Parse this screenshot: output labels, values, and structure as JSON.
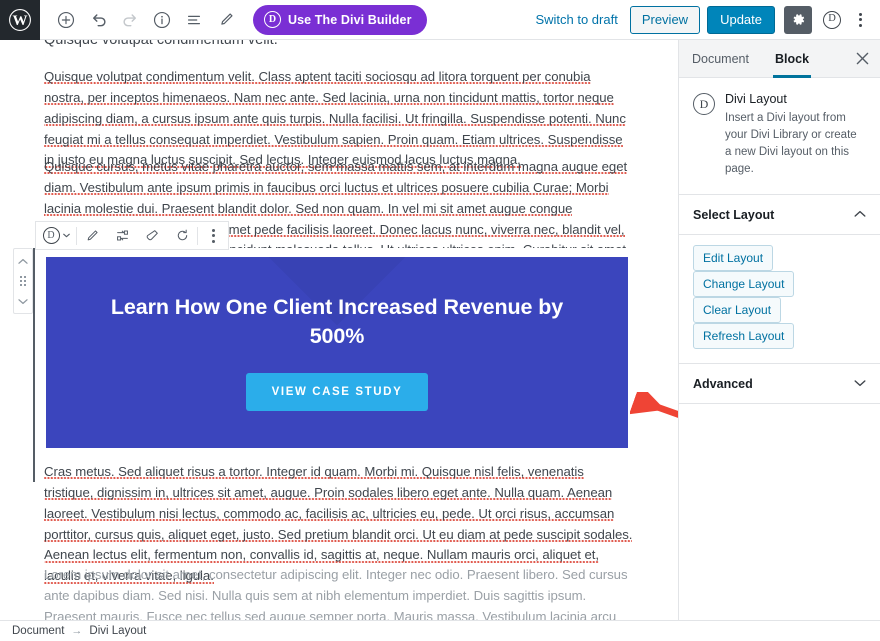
{
  "topbar": {
    "logo_icon": "wordpress-logo-icon",
    "tools": [
      {
        "name": "add-block-button",
        "icon": "plus-circle-icon",
        "disabled": false
      },
      {
        "name": "undo-button",
        "icon": "undo-arrow-icon",
        "disabled": false
      },
      {
        "name": "redo-button",
        "icon": "redo-arrow-icon",
        "disabled": true
      },
      {
        "name": "content-info-button",
        "icon": "info-circle-icon",
        "disabled": false
      },
      {
        "name": "block-navigation-button",
        "icon": "list-lines-icon",
        "disabled": false
      },
      {
        "name": "edit-mode-button",
        "icon": "pencil-icon",
        "disabled": false
      }
    ],
    "divi_builder_label": "Use The Divi Builder",
    "divi_builder_icon": "divi-d-icon",
    "divi_builder_color": "#7a2fd4",
    "switch_to_draft": "Switch to draft",
    "preview": "Preview",
    "update": "Update",
    "update_color": "#0085ba",
    "settings_icon": "gear-icon",
    "divi_toggle_icon": "divi-d-icon",
    "more_icon": "vertical-dots-icon"
  },
  "sidebar": {
    "tabs": [
      {
        "label": "Document",
        "active": false
      },
      {
        "label": "Block",
        "active": true
      }
    ],
    "close_icon": "close-x-icon",
    "block_card": {
      "icon": "divi-d-icon",
      "title": "Divi Layout",
      "description": "Insert a Divi layout from your Divi Library or create a new Divi layout on this page."
    },
    "select_layout": {
      "title": "Select Layout",
      "chevron": "chevron-up-icon",
      "buttons": [
        "Edit Layout",
        "Change Layout",
        "Clear Layout",
        "Refresh Layout"
      ]
    },
    "advanced": {
      "title": "Advanced",
      "chevron": "chevron-down-icon"
    }
  },
  "editor": {
    "clipped_top_text": "Quisque volutpat condimentum velit.",
    "paragraph_1": "Quisque volutpat condimentum velit. Class aptent taciti sociosqu ad litora torquent per conubia nostra, per inceptos himenaeos. Nam nec ante. Sed lacinia, urna non tincidunt mattis, tortor neque adipiscing diam, a cursus ipsum ante quis turpis. Nulla facilisi. Ut fringilla. Suspendisse potenti. Nunc feugiat mi a tellus consequat imperdiet. Vestibulum sapien. Proin quam. Etiam ultrices. Suspendisse in justo eu magna luctus suscipit. Sed lectus. Integer euismod lacus luctus magna.",
    "paragraph_2": "Quisque cursus, metus vitae pharetra auctor, sem massa mattis sem, at interdum magna augue eget diam. Vestibulum ante ipsum primis in faucibus orci luctus et ultrices posuere cubilia Curae; Morbi lacinia molestie dui. Praesent blandit dolor. Sed non quam. In vel mi sit amet augue congue elementum. Morbi in ipsum sit amet pede facilisis laoreet. Donec lacus nunc, viverra nec, blandit vel, egestas et, augue. Vestibulum tincidunt malesuada tellus. Ut ultrices ultrices enim. Curabitur sit amet pulvinar ullamcorper. Nulla facilisi. Integer lacinia sollicitudin massa.",
    "paragraph_3": "Cras metus. Sed aliquet risus a tortor. Integer id quam. Morbi mi. Quisque nisl felis, venenatis tristique, dignissim in, ultrices sit amet, augue. Proin sodales libero eget ante. Nulla quam. Aenean laoreet. Vestibulum nisi lectus, commodo ac, facilisis ac, ultricies eu, pede. Ut orci risus, accumsan porttitor, cursus quis, aliquet eget, justo. Sed pretium blandit orci. Ut eu diam at pede suscipit sodales. Aenean lectus elit, fermentum non, convallis id, sagittis at, neque. Nullam mauris orci, aliquet et, iaculis et, viverra vitae, ligula.",
    "paragraph_4": "Lorem ipsum dolor sit amet, consectetur adipiscing elit. Integer nec odio. Praesent libero. Sed cursus ante dapibus diam. Sed nisi. Nulla quis sem at nibh elementum imperdiet. Duis sagittis ipsum. Praesent mauris. Fusce nec tellus sed augue semper porta. Mauris massa. Vestibulum lacinia arcu eget nulla."
  },
  "divi_block": {
    "toolbar": {
      "block_type_icon": "divi-d-icon",
      "block_type_caret": "chevron-down-icon",
      "items": [
        {
          "name": "edit-layout-icon",
          "icon": "pencil-icon"
        },
        {
          "name": "change-layout-icon",
          "icon": "shuffle-icon"
        },
        {
          "name": "clear-layout-icon",
          "icon": "eraser-icon"
        },
        {
          "name": "refresh-layout-icon",
          "icon": "refresh-circle-icon"
        }
      ],
      "more_icon": "vertical-dots-icon"
    },
    "movers": {
      "up_icon": "chevron-up-icon",
      "drag_icon": "drag-grip-icon",
      "down_icon": "chevron-down-icon"
    },
    "banner": {
      "title": "Learn How One Client Increased Revenue by 500%",
      "button_label": "VIEW CASE STUDY",
      "background_color": "#3b45bd",
      "button_color": "#2badea",
      "title_color": "#ffffff"
    }
  },
  "annotation": {
    "arrow_color": "#ef4435",
    "arrow_name": "red-pointer-arrow"
  },
  "breadcrumb": {
    "items": [
      "Document",
      "Divi Layout"
    ],
    "separator": "→"
  }
}
